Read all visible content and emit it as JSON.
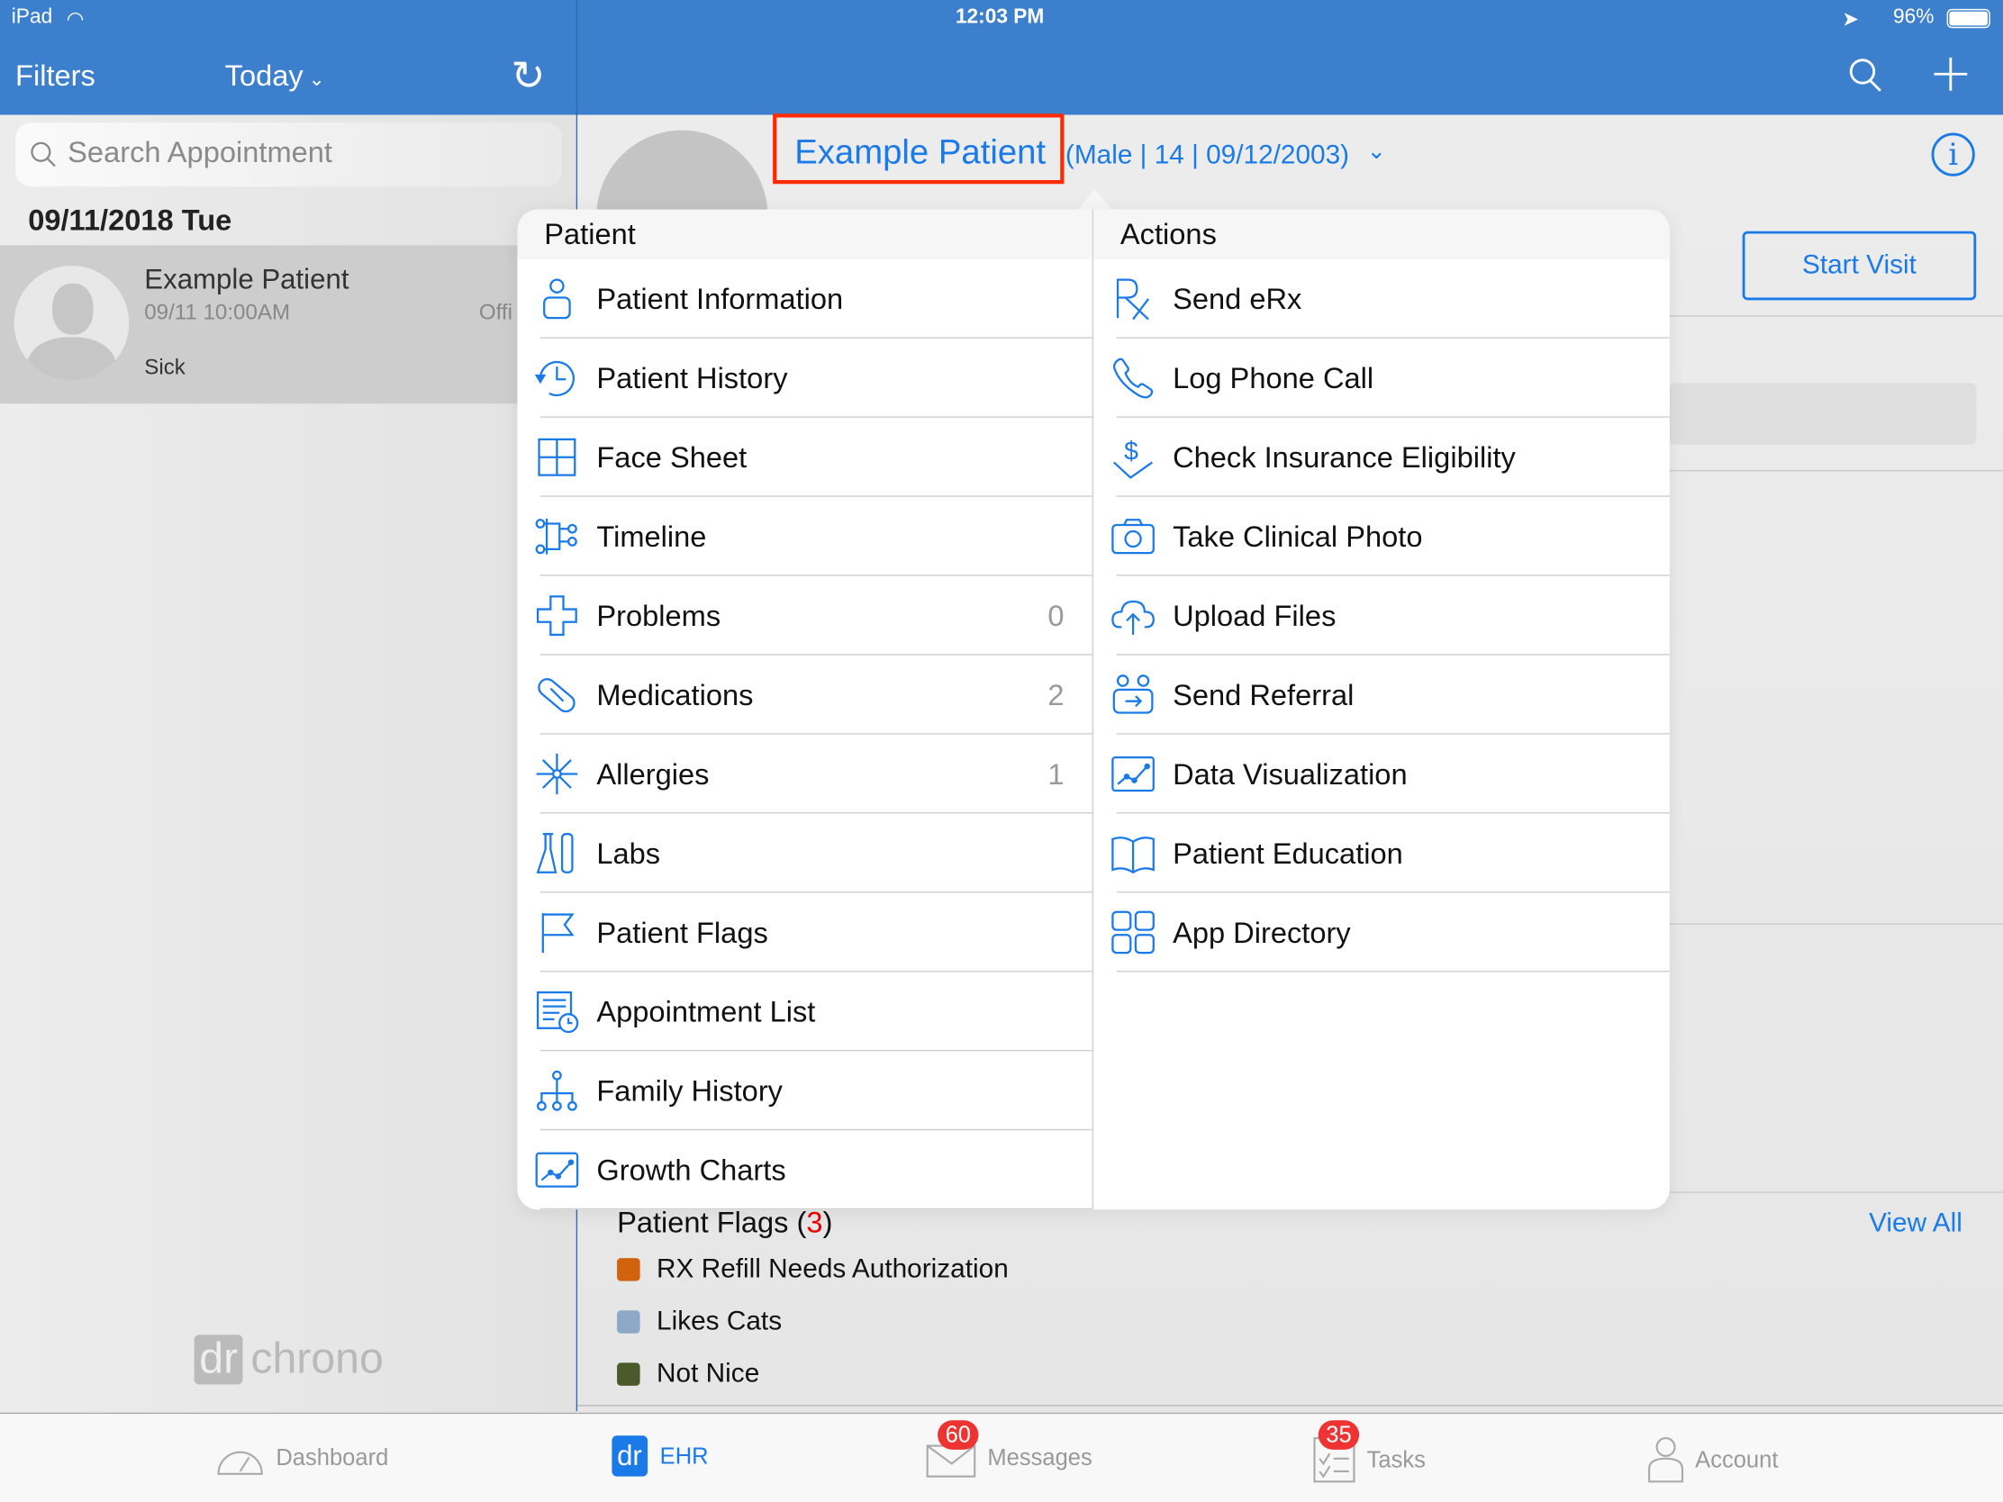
{
  "status_bar": {
    "device": "iPad",
    "time": "12:03 PM",
    "battery": "96%"
  },
  "left_nav": {
    "filters": "Filters",
    "today": "Today",
    "search_placeholder": "Search Appointment",
    "date_header": "09/11/2018 Tue"
  },
  "appointment": {
    "name": "Example Patient",
    "time": "09/11 10:00AM",
    "status_truncated": "Offi",
    "reason": "Sick"
  },
  "patient_header": {
    "name": "Example Patient",
    "details": "(Male | 14 | 09/12/2003)",
    "start_visit": "Start Visit"
  },
  "popover": {
    "patient_title": "Patient",
    "actions_title": "Actions",
    "patient_items": [
      {
        "label": "Patient Information",
        "icon": "person-icon",
        "count": ""
      },
      {
        "label": "Patient History",
        "icon": "history-icon",
        "count": ""
      },
      {
        "label": "Face Sheet",
        "icon": "grid-icon",
        "count": ""
      },
      {
        "label": "Timeline",
        "icon": "timeline-icon",
        "count": ""
      },
      {
        "label": "Problems",
        "icon": "medical-cross-icon",
        "count": "0"
      },
      {
        "label": "Medications",
        "icon": "pill-icon",
        "count": "2"
      },
      {
        "label": "Allergies",
        "icon": "allergy-burst-icon",
        "count": "1"
      },
      {
        "label": "Labs",
        "icon": "flask-icon",
        "count": ""
      },
      {
        "label": "Patient Flags",
        "icon": "flag-icon",
        "count": ""
      },
      {
        "label": "Appointment List",
        "icon": "appointment-list-icon",
        "count": ""
      },
      {
        "label": "Family History",
        "icon": "family-tree-icon",
        "count": ""
      },
      {
        "label": "Growth Charts",
        "icon": "chart-icon",
        "count": ""
      }
    ],
    "action_items": [
      {
        "label": "Send eRx",
        "icon": "rx-icon"
      },
      {
        "label": "Log Phone Call",
        "icon": "phone-icon"
      },
      {
        "label": "Check Insurance Eligibility",
        "icon": "dollar-icon"
      },
      {
        "label": "Take Clinical Photo",
        "icon": "camera-icon"
      },
      {
        "label": "Upload Files",
        "icon": "cloud-upload-icon"
      },
      {
        "label": "Send Referral",
        "icon": "referral-icon"
      },
      {
        "label": "Data Visualization",
        "icon": "chart-icon"
      },
      {
        "label": "Patient Education",
        "icon": "book-icon"
      },
      {
        "label": "App Directory",
        "icon": "apps-icon"
      }
    ]
  },
  "flags": {
    "title": "Patient Flags",
    "count": "3",
    "view_all": "View All",
    "items": [
      {
        "label": "RX Refill Needs Authorization",
        "color": "#d2620e"
      },
      {
        "label": "Likes Cats",
        "color": "#8ea8c8"
      },
      {
        "label": "Not Nice",
        "color": "#4a5a2a"
      }
    ]
  },
  "logo": {
    "text": "dr chrono"
  },
  "tabbar": {
    "dashboard": "Dashboard",
    "ehr": "EHR",
    "messages": "Messages",
    "messages_badge": "60",
    "tasks": "Tasks",
    "tasks_badge": "35",
    "account": "Account"
  },
  "colors": {
    "accent": "#1a7ae8",
    "nav": "#3b7fcd",
    "highlight": "#ff2a00"
  }
}
